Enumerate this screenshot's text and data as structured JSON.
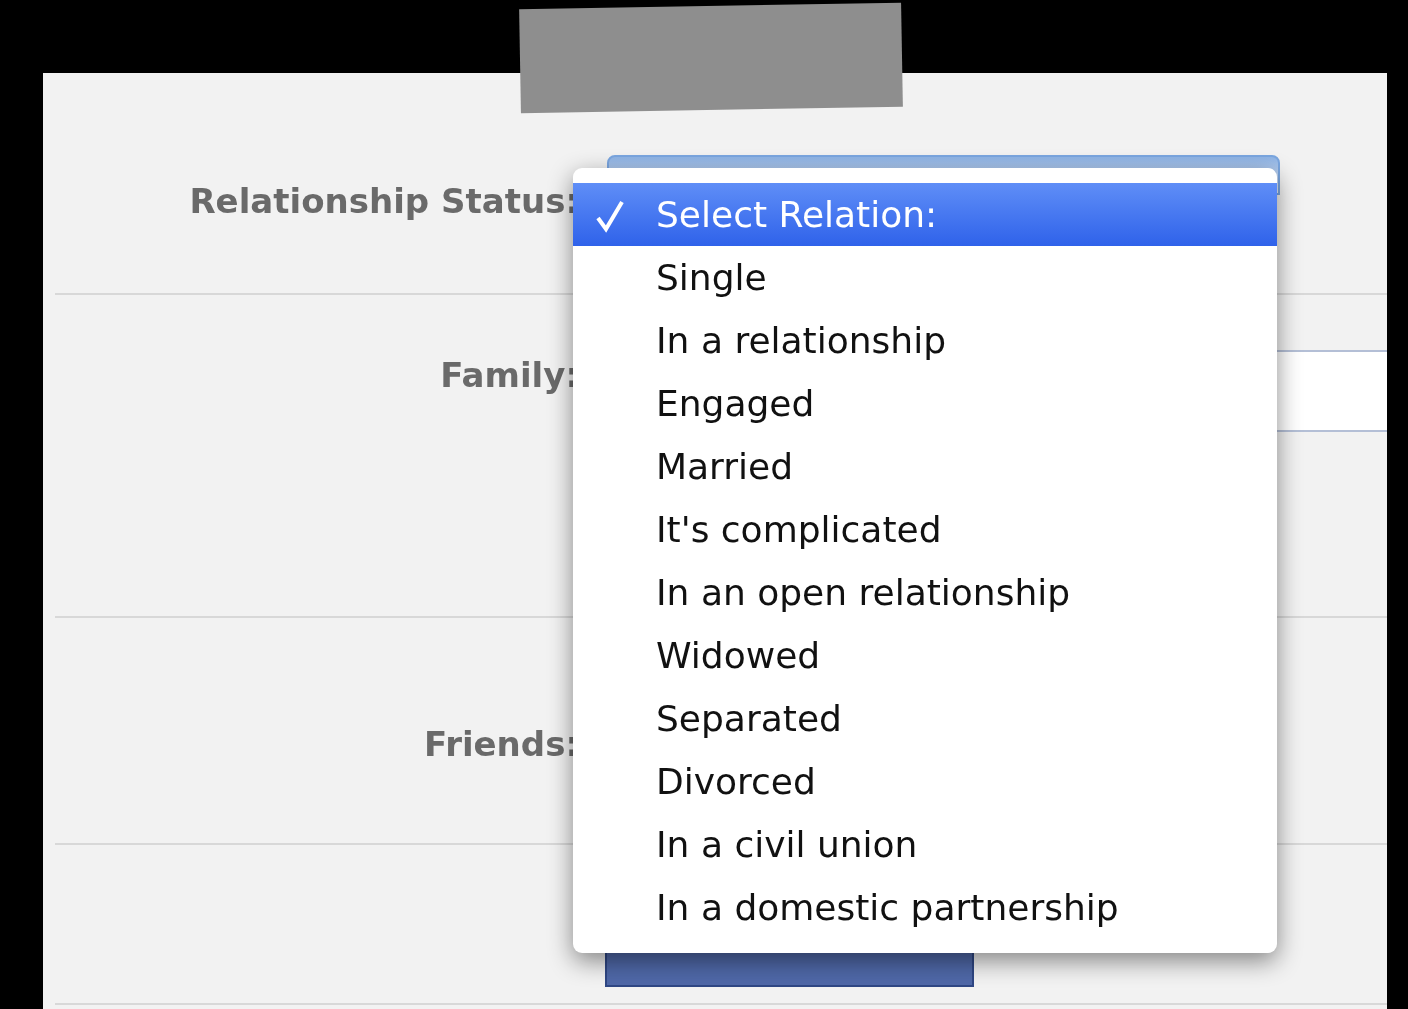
{
  "form": {
    "rows": [
      {
        "label": "Relationship Status:",
        "kind": "select"
      },
      {
        "label": "Family:",
        "kind": "field"
      },
      {
        "label": "Friends:",
        "kind": "plain"
      },
      {
        "kind": "button"
      }
    ]
  },
  "dropdown": {
    "options": [
      {
        "label": "Select Relation:",
        "selected": true
      },
      {
        "label": "Single",
        "selected": false
      },
      {
        "label": "In a relationship",
        "selected": false
      },
      {
        "label": "Engaged",
        "selected": false
      },
      {
        "label": "Married",
        "selected": false
      },
      {
        "label": "It's complicated",
        "selected": false
      },
      {
        "label": "In an open relationship",
        "selected": false
      },
      {
        "label": "Widowed",
        "selected": false
      },
      {
        "label": "Separated",
        "selected": false
      },
      {
        "label": "Divorced",
        "selected": false
      },
      {
        "label": "In a civil union",
        "selected": false
      },
      {
        "label": "In a domestic partnership",
        "selected": false
      }
    ]
  }
}
